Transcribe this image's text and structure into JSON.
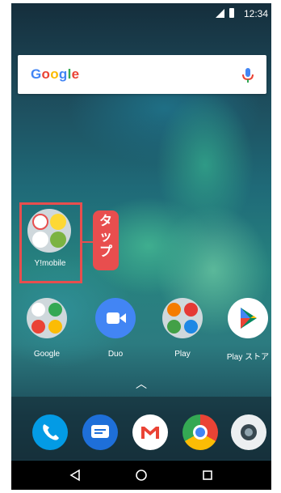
{
  "status_bar": {
    "time": "12:34"
  },
  "search": {
    "logo": "Google"
  },
  "folder": {
    "label": "Y!mobile",
    "callout": "タップ"
  },
  "apps": [
    {
      "label": "Google"
    },
    {
      "label": "Duo"
    },
    {
      "label": "Play"
    },
    {
      "label": "Play ストア"
    }
  ],
  "dock": [
    "phone-icon",
    "messages-icon",
    "gmail-icon",
    "chrome-icon",
    "camera-icon"
  ],
  "nav": [
    "back-icon",
    "home-icon",
    "recents-icon"
  ],
  "colors": {
    "highlight": "#e84e4e"
  }
}
